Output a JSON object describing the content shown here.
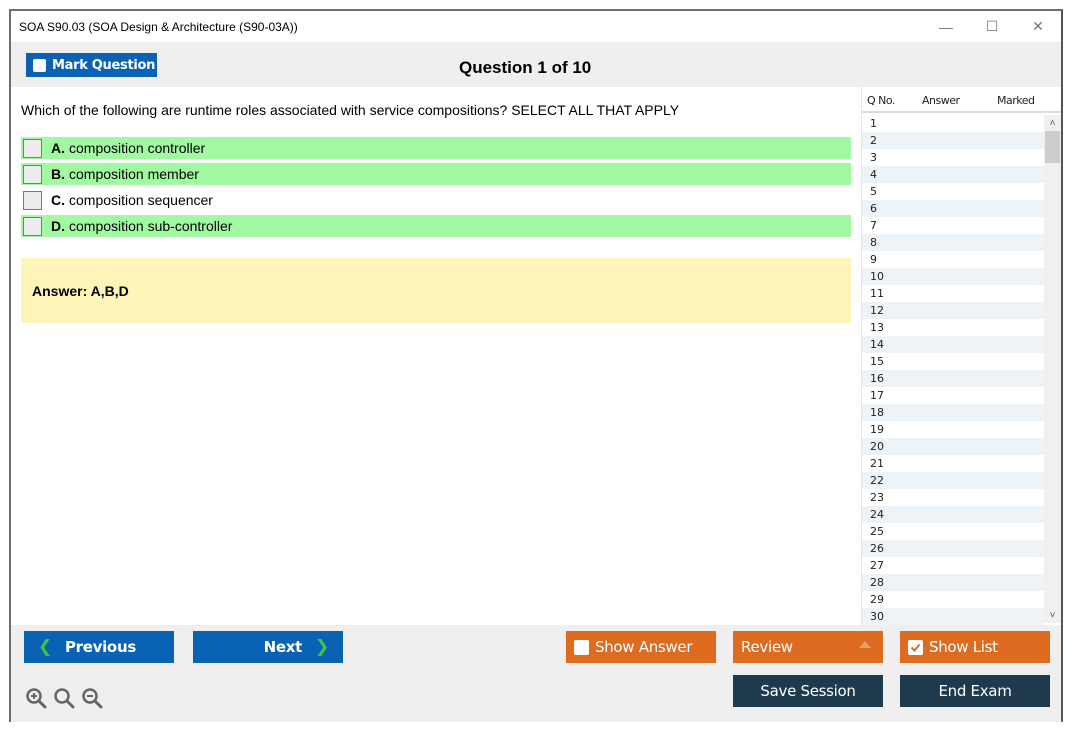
{
  "window": {
    "title": "SOA S90.03 (SOA Design & Architecture (S90-03A))",
    "controls": {
      "minimize": "—",
      "maximize": "☐",
      "close": "✕"
    }
  },
  "toolbar": {
    "mark_question_label": "Mark Question",
    "question_counter": "Question 1 of 10"
  },
  "question": {
    "text": "Which of the following are runtime roles associated with service compositions? SELECT ALL THAT APPLY",
    "options": [
      {
        "letter": "A.",
        "text": "composition controller",
        "correct": true
      },
      {
        "letter": "B.",
        "text": "composition member",
        "correct": true
      },
      {
        "letter": "C.",
        "text": "composition sequencer",
        "correct": false
      },
      {
        "letter": "D.",
        "text": "composition sub-controller",
        "correct": true
      }
    ],
    "answer": "Answer: A,B,D"
  },
  "question_list": {
    "headers": {
      "qno": "Q No.",
      "answer": "Answer",
      "marked": "Marked"
    },
    "rows": [
      "1",
      "2",
      "3",
      "4",
      "5",
      "6",
      "7",
      "8",
      "9",
      "10",
      "11",
      "12",
      "13",
      "14",
      "15",
      "16",
      "17",
      "18",
      "19",
      "20",
      "21",
      "22",
      "23",
      "24",
      "25",
      "26",
      "27",
      "28",
      "29",
      "30"
    ]
  },
  "footer": {
    "previous_label": "Previous",
    "next_label": "Next",
    "show_answer_label": "Show Answer",
    "show_answer_checked": false,
    "review_label": "Review",
    "show_list_label": "Show List",
    "show_list_checked": true,
    "save_session_label": "Save Session",
    "end_exam_label": "End Exam"
  },
  "colors": {
    "primary_blue": "#0a62b5",
    "correct_green": "#a1f9a1",
    "answer_yellow": "#fdf6b8",
    "orange": "#dd6b20",
    "dark_navy": "#1f3a4d"
  }
}
